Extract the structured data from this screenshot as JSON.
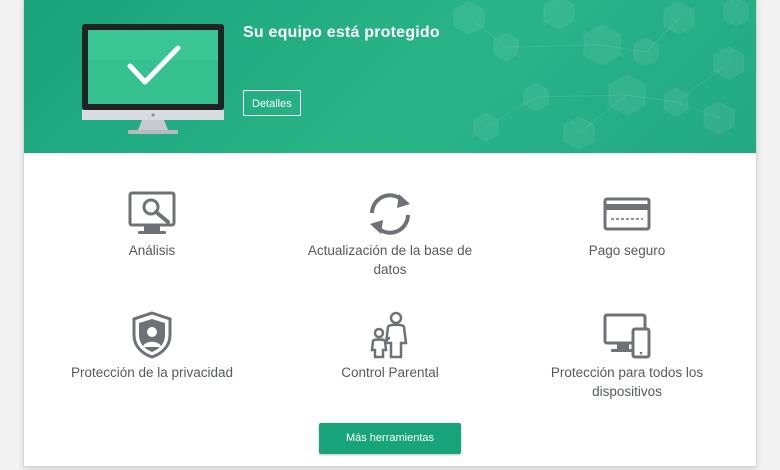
{
  "header": {
    "status_title": "Su equipo está protegido",
    "details_label": "Detalles"
  },
  "tools": [
    {
      "label": "Análisis",
      "icon": "monitor-scan-icon"
    },
    {
      "label": "Actualización de la base de datos",
      "icon": "update-arrows-icon"
    },
    {
      "label": "Pago seguro",
      "icon": "credit-card-icon"
    },
    {
      "label": "Protección de la privacidad",
      "icon": "privacy-shield-icon"
    },
    {
      "label": "Control Parental",
      "icon": "parent-child-icon"
    },
    {
      "label": "Protección para todos los dispositivos",
      "icon": "devices-icon"
    }
  ],
  "footer": {
    "more_tools_label": "Más herramientas"
  },
  "colors": {
    "brand_green": "#1aa37a",
    "icon_gray": "#6e7276",
    "text_gray": "#555a5e"
  }
}
